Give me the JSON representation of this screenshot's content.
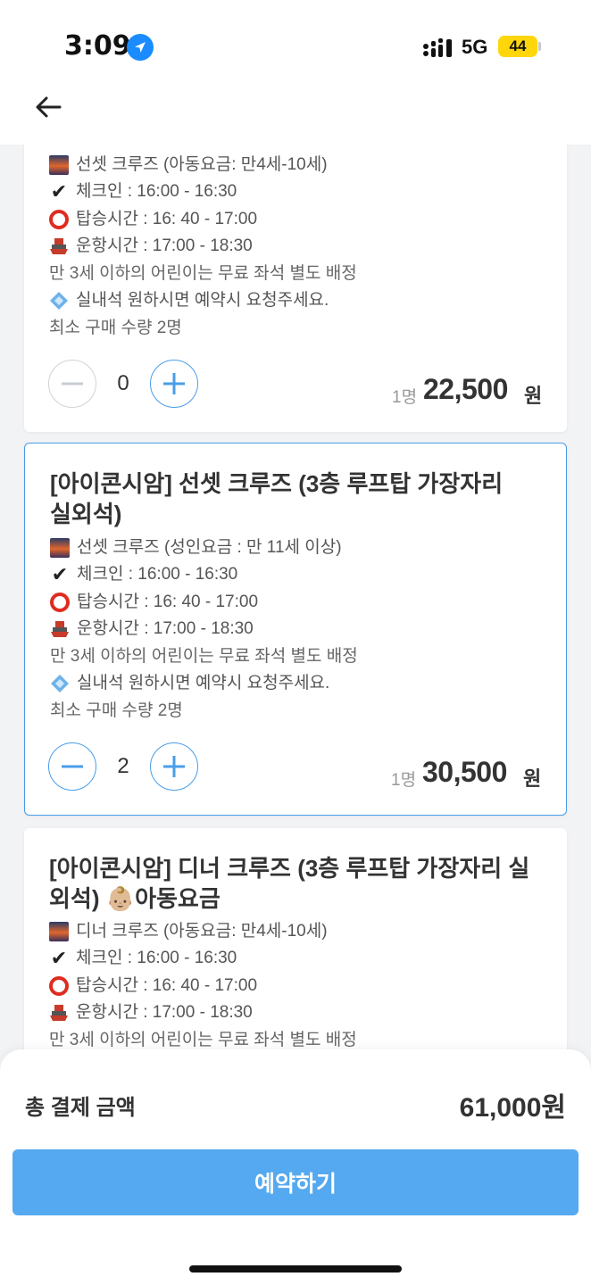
{
  "status_bar": {
    "time": "3:09",
    "network": "5G",
    "battery": "44"
  },
  "header": {
    "back_icon": "arrow-left-icon"
  },
  "colors": {
    "accent": "#4a9de8",
    "button": "#55a9f0"
  },
  "cards": [
    {
      "title": "",
      "details": [
        {
          "icon": "bridge-sunset-icon",
          "text": "선셋 크루즈 (아동요금: 만4세-10세)"
        },
        {
          "icon": "check-icon",
          "text": "체크인 : 16:00 - 16:30"
        },
        {
          "icon": "circle-icon",
          "text": "탑승시간 : 16: 40 - 17:00"
        },
        {
          "icon": "ship-icon",
          "text": "운항시간 : 17:00 - 18:30"
        },
        {
          "icon": "",
          "text": "만 3세 이하의 어린이는 무료 좌석 별도 배정"
        },
        {
          "icon": "diamond-icon",
          "text": "실내석 원하시면 예약시 요청주세요."
        },
        {
          "icon": "",
          "text": "최소 구매 수량 2명"
        }
      ],
      "quantity": "0",
      "price_unit": "1명",
      "price": "22,500",
      "currency": "원"
    },
    {
      "title": "[아이콘시암] 선셋 크루즈 (3층 루프탑 가장자리 실외석)",
      "details": [
        {
          "icon": "bridge-sunset-icon",
          "text": "선셋 크루즈 (성인요금 : 만 11세 이상)"
        },
        {
          "icon": "check-icon",
          "text": "체크인 : 16:00 - 16:30"
        },
        {
          "icon": "circle-icon",
          "text": "탑승시간 : 16: 40 - 17:00"
        },
        {
          "icon": "ship-icon",
          "text": "운항시간 : 17:00 - 18:30"
        },
        {
          "icon": "",
          "text": "만 3세 이하의 어린이는 무료 좌석 별도 배정"
        },
        {
          "icon": "diamond-icon",
          "text": "실내석 원하시면 예약시 요청주세요."
        },
        {
          "icon": "",
          "text": "최소 구매 수량 2명"
        }
      ],
      "quantity": "2",
      "price_unit": "1명",
      "price": "30,500",
      "currency": "원"
    },
    {
      "title": "[아이콘시암] 디너 크루즈 (3층 루프탑 가장자리 실외석) 👶🏼아동요금",
      "details": [
        {
          "icon": "bridge-sunset-icon",
          "text": "디너 크루즈 (아동요금: 만4세-10세)"
        },
        {
          "icon": "check-icon",
          "text": "체크인 : 16:00 - 16:30"
        },
        {
          "icon": "circle-icon",
          "text": "탑승시간 : 16: 40 - 17:00"
        },
        {
          "icon": "ship-icon",
          "text": "운항시간 : 17:00 - 18:30"
        },
        {
          "icon": "",
          "text": "만 3세 이하의 어린이는 무료 좌석 별도 배정"
        }
      ]
    }
  ],
  "footer": {
    "total_label": "총 결제 금액",
    "total_value": "61,000원",
    "book_button": "예약하기"
  }
}
